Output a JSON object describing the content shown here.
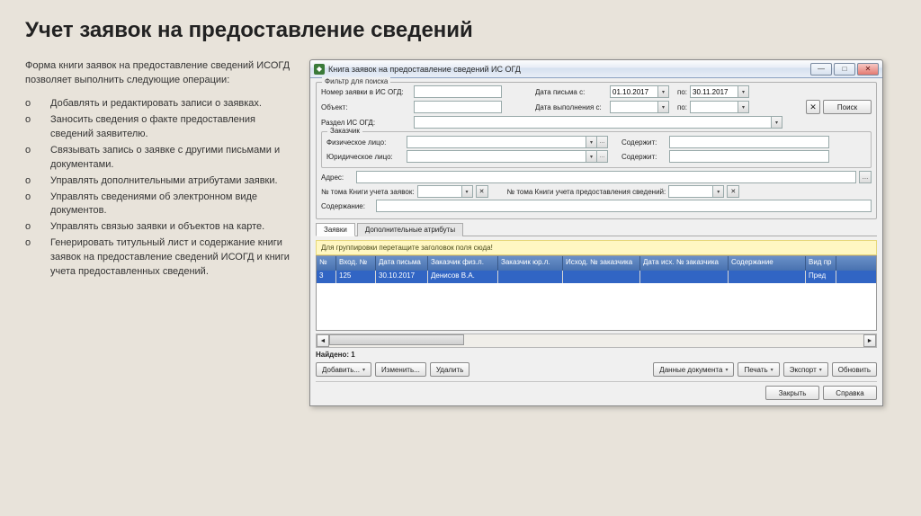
{
  "slide": {
    "title": "Учет заявок на предоставление сведений",
    "intro": "Форма книги заявок на предоставление сведений ИСОГД позволяет  выполнить следующие операции:",
    "bullets": [
      "Добавлять и редактировать записи о заявках.",
      "Заносить сведения о факте предоставления сведений заявителю.",
      "Связывать запись о заявке с другими письмами и документами.",
      "Управлять дополнительными атрибутами заявки.",
      "Управлять сведениями об электронном виде документов.",
      "Управлять связью заявки и объектов на карте.",
      "Генерировать титульный лист и содержание книги заявок на предоставление сведений ИСОГД и книги учета предоставленных сведений."
    ],
    "bullet_mark": "o"
  },
  "window": {
    "title": "Книга заявок на предоставление сведений ИС ОГД",
    "filter_legend": "Фильтр для поиска",
    "labels": {
      "nomer": "Номер заявки в ИС ОГД:",
      "data_pisma": "Дата письма    с:",
      "po": "по:",
      "date_from": "01.10.2017",
      "date_to": "30.11.2017",
      "object": "Объект:",
      "data_vyp": "Дата выполнения с:",
      "razdel": "Раздел ИС ОГД:",
      "zakazchik": "Заказчик",
      "fiz": "Физическое лицо:",
      "yur": "Юридическое лицо:",
      "soderjit1": "Содержит:",
      "soderjit2": "Содержит:",
      "adres": "Адрес:",
      "tom1": "№ тома Книги учета заявок:",
      "tom2": "№ тома Книги учета предоставления сведений:",
      "soderzh": "Содержание:",
      "poisk": "Поиск"
    },
    "tabs": {
      "t1": "Заявки",
      "t2": "Дополнительные атрибуты"
    },
    "group_hint": "Для группировки перетащите заголовок поля сюда!",
    "grid": {
      "headers": [
        "№",
        "Вход. №",
        "Дата письма",
        "Заказчик физ.л.",
        "Заказчик юр.л.",
        "Исход. № заказчика",
        "Дата исх. № заказчика",
        "Содержание",
        "Вид пр"
      ],
      "row": [
        "3",
        "125",
        "30.10.2017",
        "Денисов В.А.",
        "",
        "",
        "",
        "",
        "Пред"
      ]
    },
    "found_label": "Найдено:",
    "found_val": "1",
    "buttons": {
      "add": "Добавить...",
      "edit": "Изменить...",
      "del": "Удалить",
      "docs": "Данные документа",
      "print": "Печать",
      "export": "Экспорт",
      "refresh": "Обновить",
      "close": "Закрыть",
      "help": "Справка"
    }
  }
}
